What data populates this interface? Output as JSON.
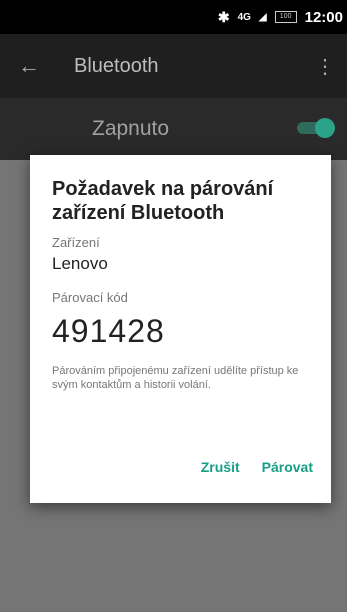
{
  "status_bar": {
    "network": "4G",
    "network_superscript": "4G",
    "battery": "100",
    "time": "12:00"
  },
  "app_bar": {
    "title": "Bluetooth",
    "back_icon": "arrow-left-icon",
    "more_icon": "more-vert-icon"
  },
  "toggle": {
    "label": "Zapnuto",
    "state": "on"
  },
  "dialog": {
    "title": "Požadavek na párování zařízení Bluetooth",
    "device_label": "Zařízení",
    "device_name": "Lenovo",
    "pin_label": "Párovací kód",
    "pin": "491428",
    "message": "Párováním připojenému zařízení udělíte přístup ke svým kontaktům a historii volání.",
    "cancel_label": "Zrušit",
    "pair_label": "Párovat"
  },
  "colors": {
    "accent": "#169f86",
    "switch_thumb": "#2aa388"
  }
}
